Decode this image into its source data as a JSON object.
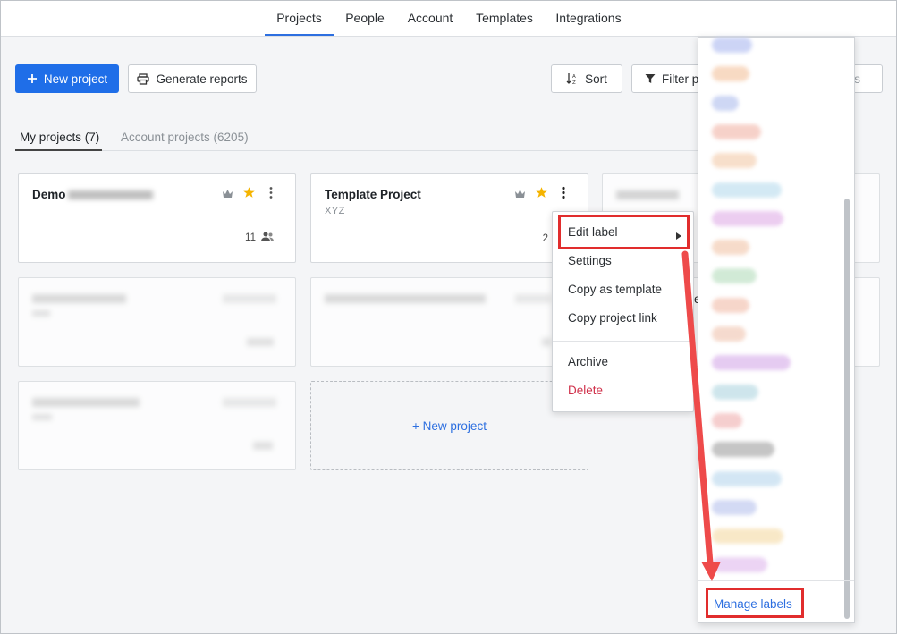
{
  "nav": {
    "tabs": [
      "Projects",
      "People",
      "Account",
      "Templates",
      "Integrations"
    ],
    "active": "Projects"
  },
  "toolbar": {
    "new_project": "New project",
    "generate_reports": "Generate reports",
    "sort": "Sort",
    "filter": "Filter p",
    "search_partial": "s"
  },
  "subtabs": {
    "my_projects": "My projects (7)",
    "account_projects": "Account projects (6205)"
  },
  "cards": [
    {
      "title": "Demo",
      "subtitle": "",
      "members": "11",
      "starred": true
    },
    {
      "title": "Template Project",
      "subtitle": "XYZ",
      "members": "2",
      "starred": true
    }
  ],
  "new_project_card": "+ New project",
  "context_menu": {
    "items": [
      "Edit label",
      "Settings",
      "Copy as template",
      "Copy project link"
    ],
    "archive": "Archive",
    "delete": "Delete",
    "partial_text": "e"
  },
  "labels_menu": {
    "manage": "Manage labels",
    "label_colors": [
      "#c7d0f5",
      "#f7d6bd",
      "#c9d3f3",
      "#f6cdc4",
      "#f7dcc6",
      "#cfe7f3",
      "#eac8ef",
      "#f6d8c5",
      "#cde8d2",
      "#f6d2c5",
      "#f5d7c9",
      "#e3c6f0",
      "#c9e3ea",
      "#f5c9c9",
      "#bfbfbf",
      "#cfe4f3",
      "#cfd6f3",
      "#f8e6c2",
      "#ead0f3"
    ]
  },
  "colors": {
    "accent": "#1f6ee8",
    "highlight": "#e12d2d",
    "star": "#f5b400",
    "danger": "#d0304a"
  }
}
